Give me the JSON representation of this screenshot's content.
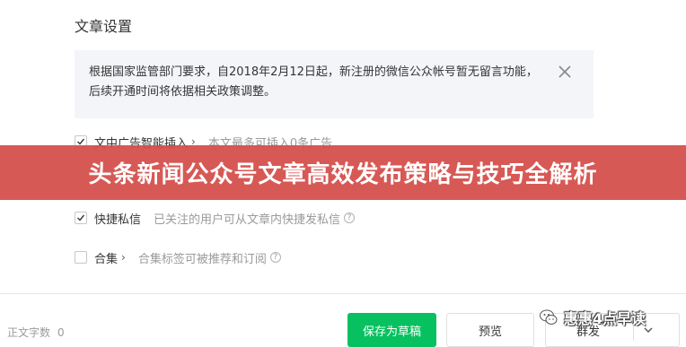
{
  "settings": {
    "section_title": "文章设置",
    "notice": {
      "text": "根据国家监管部门要求，自2018年2月12日起，新注册的微信公众帐号暂无留言功能，后续开通时间将依据相关政策调整。",
      "close_icon": "close-icon"
    },
    "options": [
      {
        "label": "文中广告智能插入",
        "has_chevron": true,
        "description": "本文最多可插入0条广告",
        "checked": true
      },
      {
        "label": "快捷私信",
        "has_chevron": false,
        "description": "已关注的用户可从文章内快捷发私信",
        "checked": true,
        "help_icon": "?"
      },
      {
        "label": "合集",
        "has_chevron": true,
        "description": "合集标签可被推荐和订阅",
        "checked": false,
        "help_icon": "?"
      }
    ]
  },
  "banner": {
    "title": "头条新闻公众号文章高效发布策略与技巧全解析",
    "color": "#d44c48"
  },
  "footer": {
    "word_count_label": "正文字数",
    "word_count_value": "0",
    "save_draft_label": "保存为草稿",
    "preview_label": "预览",
    "publish_label": "群发",
    "accent_color": "#07c160"
  },
  "watermark": {
    "text": "惠惠4点早读",
    "icon": "wechat-icon"
  }
}
